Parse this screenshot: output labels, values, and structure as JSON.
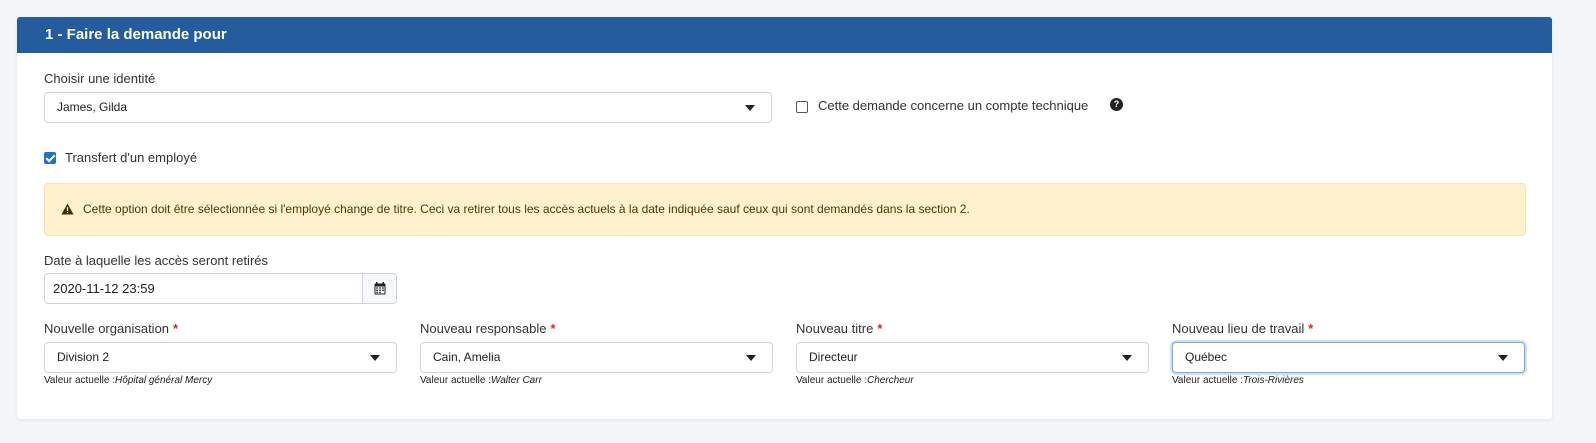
{
  "section": {
    "title": "1 - Faire la demande pour"
  },
  "identity": {
    "label": "Choisir une identité",
    "value": "James, Gilda"
  },
  "technical_account": {
    "label": "Cette demande concerne un compte technique",
    "checked": false,
    "help": "?"
  },
  "transfer": {
    "label": "Transfert d'un employé",
    "checked": true
  },
  "alert": {
    "text": "Cette option doit être sélectionnée si l'employé change de titre. Ceci va retirer tous les accès actuels à la date indiquée sauf ceux qui sont demandés dans la section 2."
  },
  "removal_date": {
    "label": "Date à laquelle les accès seront retirés",
    "value": "2020-11-12 23:59"
  },
  "fields": {
    "organisation": {
      "label": "Nouvelle organisation",
      "value": "Division 2",
      "current_prefix": "Valeur actuelle :",
      "current": "Hôpital général Mercy"
    },
    "manager": {
      "label": "Nouveau responsable",
      "value": "Cain, Amelia",
      "current_prefix": "Valeur actuelle :",
      "current": "Walter Carr"
    },
    "title": {
      "label": "Nouveau titre",
      "value": "Directeur",
      "current_prefix": "Valeur actuelle :",
      "current": "Chercheur"
    },
    "workplace": {
      "label": "Nouveau lieu de travail",
      "value": "Québec",
      "current_prefix": "Valeur actuelle :",
      "current": "Trois-Rivières"
    }
  },
  "required_mark": "*",
  "colors": {
    "header": "#245c9e",
    "alert_bg": "#fff2cc",
    "required": "#c9302c",
    "checkbox": "#1e6fd9"
  }
}
